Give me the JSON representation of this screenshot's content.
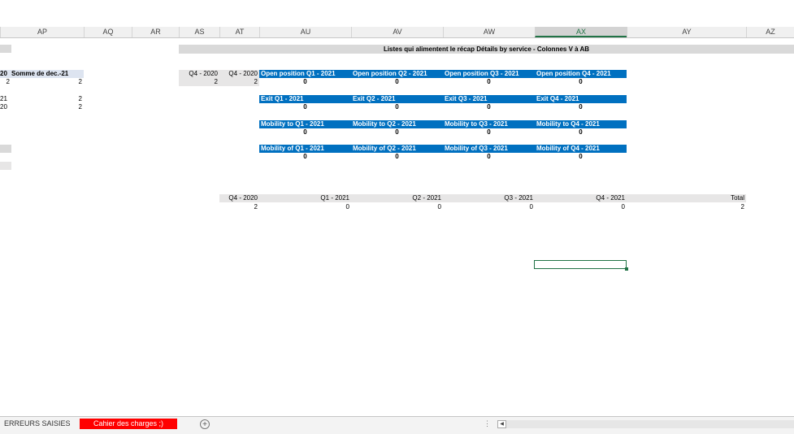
{
  "columns": [
    "AP",
    "AQ",
    "AR",
    "AS",
    "AT",
    "AU",
    "AV",
    "AW",
    "AX",
    "AY",
    "AZ"
  ],
  "selected_column": "AX",
  "banner": "Listes qui alimentent le récap Détails by service - Colonnes V à AB",
  "left_pivot": {
    "header_clip": "20",
    "header": "Somme de dec.-21",
    "row1_clip": "2",
    "row1_val": "2",
    "row2_clip": "21",
    "row2_val": "2",
    "row3_clip": "20",
    "row3_val": "2"
  },
  "as_at": {
    "h1": "Q4 - 2020",
    "h2": "Q4 - 2020",
    "v1": "2",
    "v2": "2"
  },
  "blocks": [
    {
      "headers": [
        "Open position Q1 - 2021",
        "Open position Q2 - 2021",
        "Open position Q3 - 2021",
        "Open position Q4 - 2021"
      ],
      "values": [
        "0",
        "0",
        "0",
        "0"
      ]
    },
    {
      "headers": [
        "Exit Q1 - 2021",
        "Exit Q2 - 2021",
        "Exit Q3 - 2021",
        "Exit Q4 - 2021"
      ],
      "values": [
        "0",
        "0",
        "0",
        "0"
      ]
    },
    {
      "headers": [
        "Mobility to Q1 - 2021",
        "Mobility to Q2 - 2021",
        "Mobility to Q3 - 2021",
        "Mobility to Q4 - 2021"
      ],
      "values": [
        "0",
        "0",
        "0",
        "0"
      ]
    },
    {
      "headers": [
        "Mobility of Q1 - 2021",
        "Mobility of Q2 - 2021",
        "Mobility of Q3 - 2021",
        "Mobility of Q4 - 2021"
      ],
      "values": [
        "0",
        "0",
        "0",
        "0"
      ]
    }
  ],
  "summary": {
    "headers": [
      "Q4 - 2020",
      "Q1 - 2021",
      "Q2 - 2021",
      "Q3 - 2021",
      "Q4 - 2021",
      "Total"
    ],
    "values": [
      "2",
      "0",
      "0",
      "0",
      "0",
      "2"
    ]
  },
  "tabs": {
    "erreurs": "ERREURS SAISIES",
    "cahier": "Cahier des charges ;)"
  },
  "add_sheet_glyph": "+",
  "scroll_dots": "⋮",
  "scroll_left_glyph": "◀",
  "accent_color": "#217346",
  "header_blue": "#0070c0",
  "active_tab_color": "#ff0000"
}
